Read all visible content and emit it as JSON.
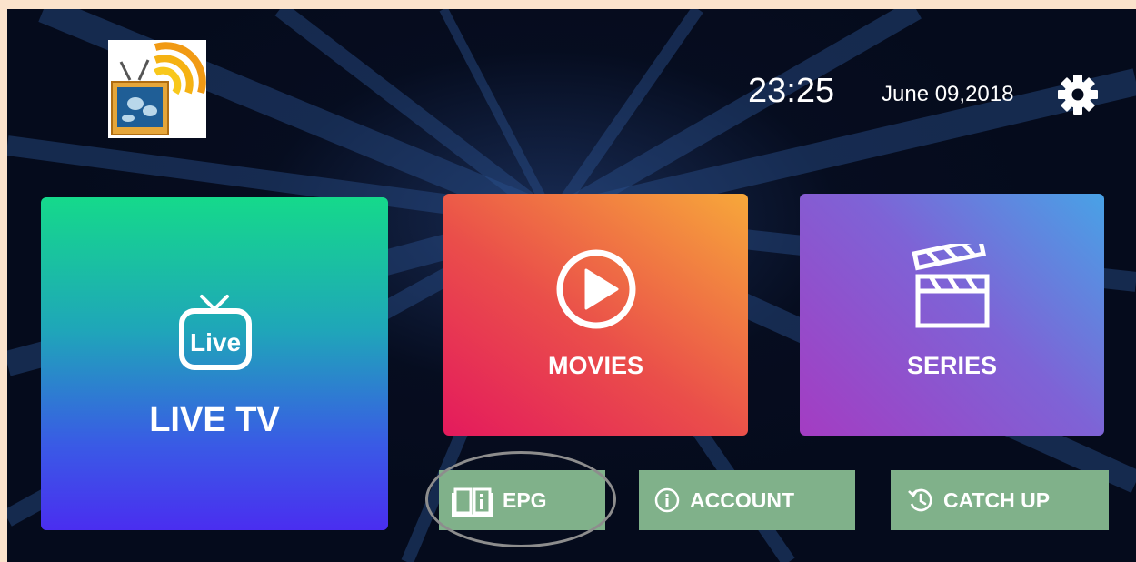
{
  "header": {
    "logo_icon": "tv-world-signal-logo",
    "time": "23:25",
    "date": "June 09,2018",
    "settings_icon": "gear-icon"
  },
  "tiles": {
    "live": {
      "label": "LIVE TV",
      "icon_text": "Live",
      "icon": "live-tv-icon"
    },
    "movies": {
      "label": "MOVIES",
      "icon": "play-circle-icon"
    },
    "series": {
      "label": "SERIES",
      "icon": "clapperboard-icon"
    }
  },
  "buttons": {
    "epg": {
      "label": "EPG",
      "icon": "book-info-icon"
    },
    "account": {
      "label": "ACCOUNT",
      "icon": "info-circle-icon"
    },
    "catchup": {
      "label": "CATCH UP",
      "icon": "history-icon"
    }
  },
  "colors": {
    "button_bg": "#80b18a",
    "live_gradient": [
      "#15d98b",
      "#4a2ef0"
    ],
    "movies_gradient": [
      "#e41a5d",
      "#f7a83a"
    ],
    "series_gradient": [
      "#a43cc2",
      "#48a2e6"
    ],
    "background": "#050b1c",
    "frame": "#fbe3cc"
  }
}
